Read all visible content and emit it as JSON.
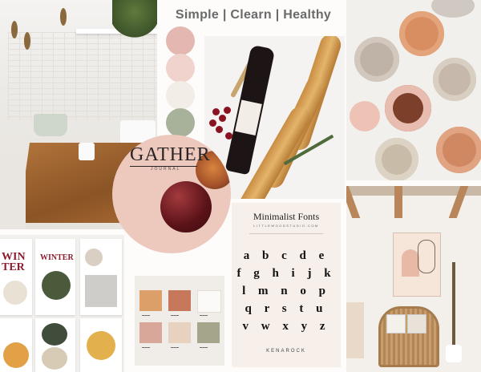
{
  "header": {
    "title": "Simple | Clearn | Healthy"
  },
  "gather": {
    "title": "GATHER",
    "subtitle": "JOURNAL"
  },
  "fonts_card": {
    "title": "Minimalist Fonts",
    "url": "LITTLEWOODSTUDIO.COM",
    "rows": [
      "a b c d e",
      "f g h i j k",
      "l m n o p",
      "q r s t u",
      "v w x y z"
    ],
    "brand": "KENAROCK"
  },
  "winter_card": {
    "title1": "WIN",
    "title2": "TER",
    "title3": "WINTER"
  },
  "palette_swatches": [
    {
      "color": "#dc9f6a"
    },
    {
      "color": "#c8785a"
    },
    {
      "color": "#fbfaf8"
    },
    {
      "color": "#d9a69a"
    },
    {
      "color": "#e7d2c0"
    },
    {
      "color": "#a4a58a"
    }
  ],
  "circle_swatches": [
    "#e4b7b1",
    "#efd3cc",
    "#f3ede8",
    "#a8b29b"
  ]
}
